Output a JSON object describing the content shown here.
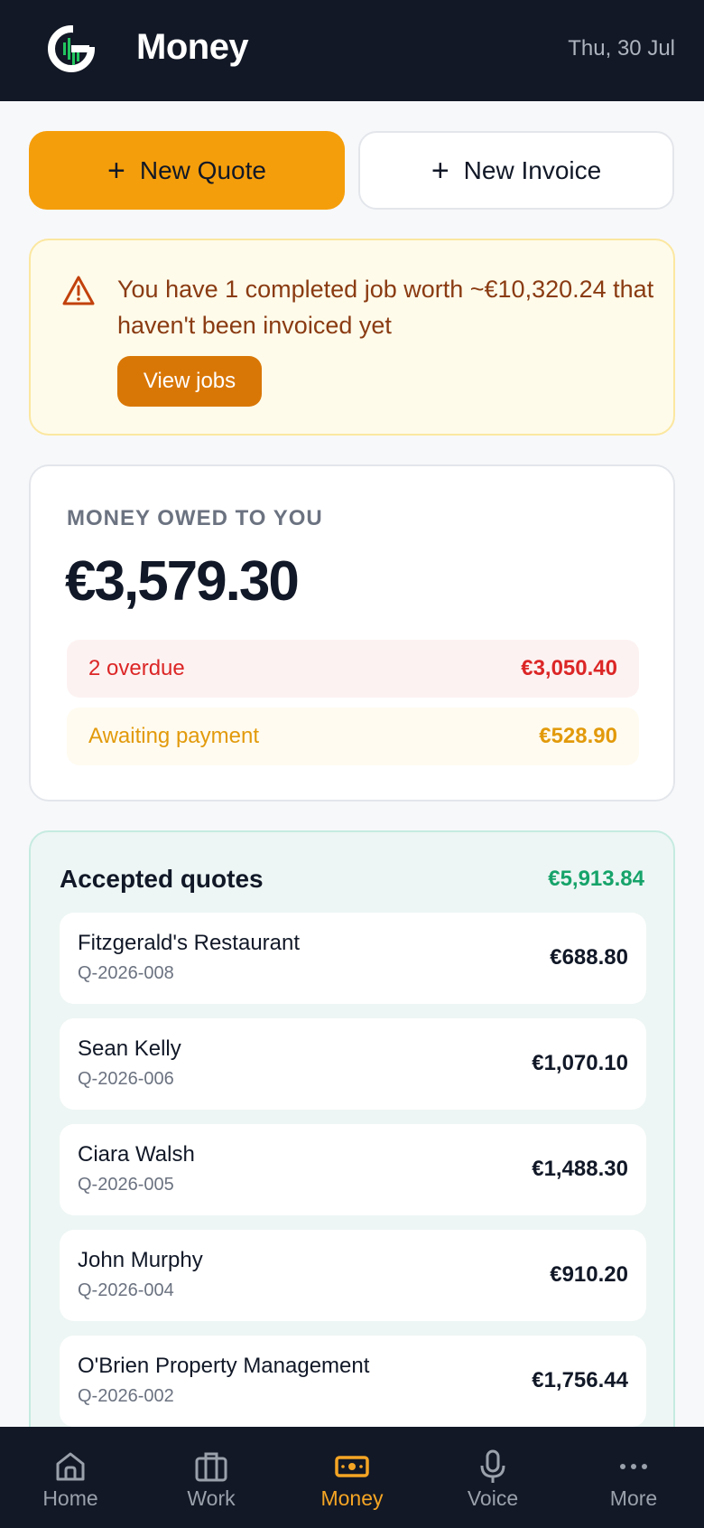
{
  "header": {
    "title": "Money",
    "date": "Thu, 30 Jul"
  },
  "actions": {
    "new_quote": "New Quote",
    "new_invoice": "New Invoice"
  },
  "alert": {
    "message": "You have 1 completed job worth ~€10,320.24 that haven't been invoiced yet",
    "button": "View jobs"
  },
  "owed": {
    "label": "MONEY OWED TO YOU",
    "amount": "€3,579.30",
    "overdue_label": "2 overdue",
    "overdue_amount": "€3,050.40",
    "awaiting_label": "Awaiting payment",
    "awaiting_amount": "€528.90"
  },
  "accepted": {
    "title": "Accepted quotes",
    "total": "€5,913.84",
    "quotes": [
      {
        "name": "Fitzgerald's Restaurant",
        "id": "Q-2026-008",
        "amount": "€688.80"
      },
      {
        "name": "Sean Kelly",
        "id": "Q-2026-006",
        "amount": "€1,070.10"
      },
      {
        "name": "Ciara Walsh",
        "id": "Q-2026-005",
        "amount": "€1,488.30"
      },
      {
        "name": "John Murphy",
        "id": "Q-2026-004",
        "amount": "€910.20"
      },
      {
        "name": "O'Brien Property Management",
        "id": "Q-2026-002",
        "amount": "€1,756.44"
      }
    ]
  },
  "nav": {
    "items": [
      {
        "label": "Home",
        "icon": "home-icon"
      },
      {
        "label": "Work",
        "icon": "briefcase-icon"
      },
      {
        "label": "Money",
        "icon": "money-icon",
        "active": true
      },
      {
        "label": "Voice",
        "icon": "microphone-icon"
      },
      {
        "label": "More",
        "icon": "more-icon"
      }
    ]
  },
  "colors": {
    "header_bg": "#121826",
    "accent": "#f59e0b",
    "alert_text": "#8a3b12",
    "overdue": "#dc2626",
    "awaiting": "#e29a0b",
    "accepted_total": "#16a36a"
  }
}
